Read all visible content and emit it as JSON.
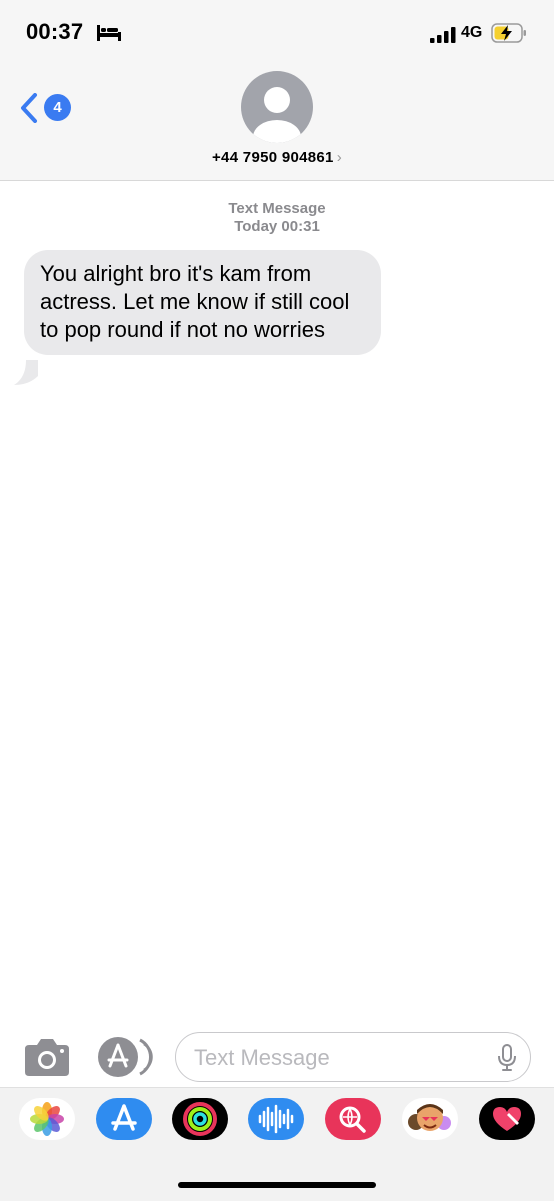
{
  "status_bar": {
    "time": "00:37",
    "network": "4G",
    "icons": [
      "bed-icon",
      "signal-icon",
      "battery-charging-icon"
    ]
  },
  "header": {
    "back_badge": "4",
    "contact": "+44 7950 904861",
    "contact_chevron": "›"
  },
  "thread": {
    "service_label": "Text Message",
    "timestamp": "Today 00:31",
    "messages": [
      {
        "direction": "incoming",
        "text": "You alright bro it's kam from actress. Let me know if still cool to pop round if not no worries"
      }
    ]
  },
  "composer": {
    "placeholder": "Text Message",
    "icons": [
      "camera-icon",
      "app-store-icon",
      "microphone-icon"
    ]
  },
  "app_drawer": {
    "apps": [
      "photos-app-icon",
      "app-store-app-icon",
      "fitness-app-icon",
      "audio-message-app-icon",
      "images-search-app-icon",
      "memoji-app-icon",
      "digital-touch-app-icon"
    ]
  },
  "colors": {
    "accent": "#3a7bf1",
    "incoming_bubble": "#e9e9eb",
    "header_bg": "#f6f6f6",
    "battery_charging": "#f5d02f"
  }
}
